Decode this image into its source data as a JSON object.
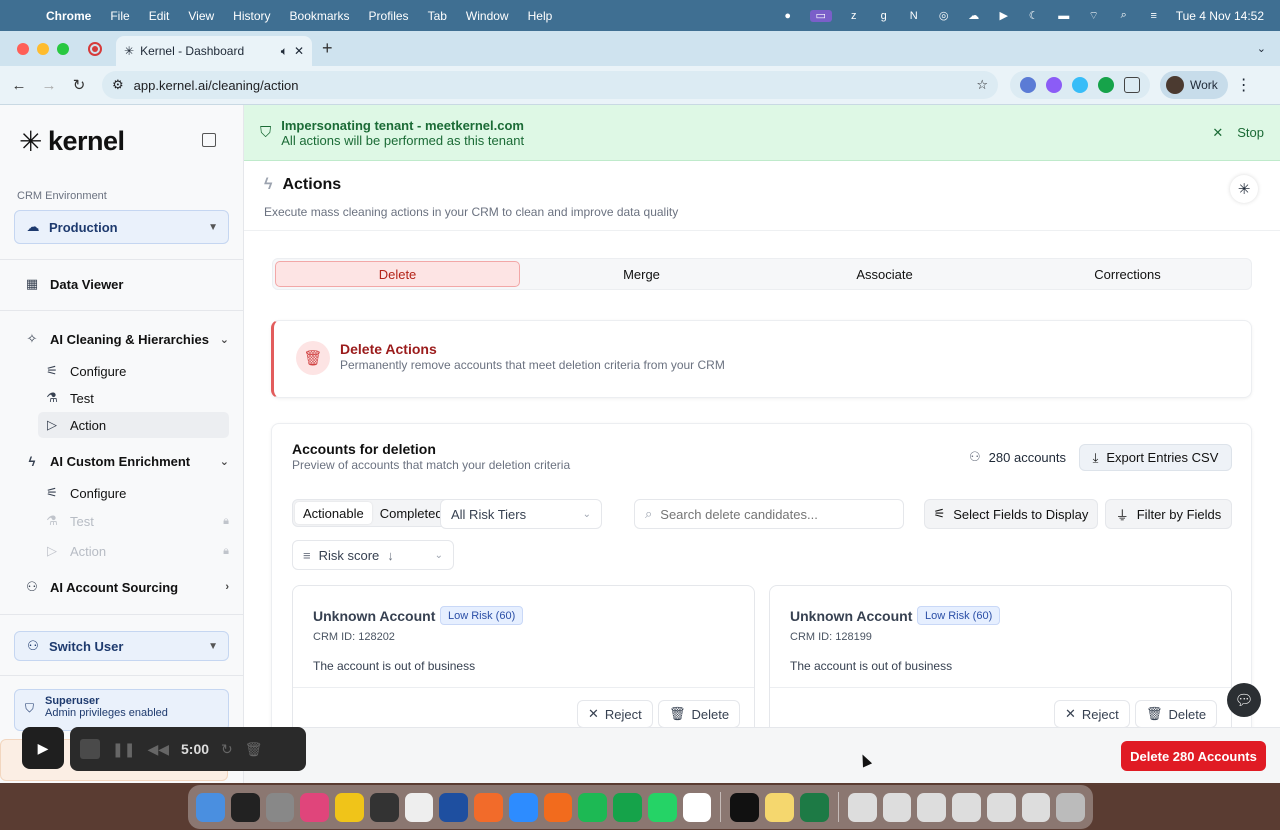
{
  "os": {
    "menubar": {
      "apple_icon": "apple-icon",
      "app_name": "Chrome",
      "menus": [
        "File",
        "Edit",
        "View",
        "History",
        "Bookmarks",
        "Profiles",
        "Tab",
        "Window",
        "Help"
      ],
      "datetime": "Tue 4 Nov  14:52"
    },
    "dock_app_count": 28
  },
  "browser": {
    "tab_title": "Kernel - Dashboard",
    "url": "app.kernel.ai/cleaning/action",
    "profile_label": "Work"
  },
  "sidebar": {
    "logo_text": "kernel",
    "env_label": "CRM Environment",
    "env_value": "Production",
    "data_viewer": "Data Viewer",
    "ai_cleaning": {
      "label": "AI Cleaning & Hierarchies",
      "items": [
        "Configure",
        "Test",
        "Action"
      ]
    },
    "ai_enrichment": {
      "label": "AI Custom Enrichment",
      "items": [
        "Configure",
        "Test",
        "Action"
      ]
    },
    "ai_sourcing": "AI Account Sourcing",
    "switch_user": "Switch User",
    "superuser_title": "Superuser",
    "superuser_sub": "Admin privileges enabled"
  },
  "banner": {
    "title": "Impersonating tenant - meetkernel.com",
    "subtitle": "All actions will be performed as this tenant",
    "stop_label": "Stop"
  },
  "page": {
    "title": "Actions",
    "subtitle": "Execute mass cleaning actions in your CRM to clean and improve data quality"
  },
  "tabs": [
    "Delete",
    "Merge",
    "Associate",
    "Corrections"
  ],
  "delete_card": {
    "title": "Delete Actions",
    "subtitle": "Permanently remove accounts that meet deletion criteria from your CRM"
  },
  "accounts": {
    "title": "Accounts for deletion",
    "subtitle": "Preview of accounts that match your deletion criteria",
    "count_label": "280 accounts",
    "export_label": "Export Entries CSV",
    "seg_actionable": "Actionable",
    "seg_completed": "Completed",
    "risk_filter": "All Risk Tiers",
    "search_placeholder": "Search delete candidates...",
    "select_fields": "Select Fields to Display",
    "filter_fields": "Filter by Fields",
    "sort_label": "Risk score",
    "cards": [
      {
        "name": "Unknown Account",
        "badge": "Low Risk (60)",
        "crm_id": "CRM ID: 128202",
        "reason": "The account is out of business",
        "reject": "Reject",
        "delete": "Delete"
      },
      {
        "name": "Unknown Account",
        "badge": "Low Risk (60)",
        "crm_id": "CRM ID: 128199",
        "reason": "The account is out of business",
        "reject": "Reject",
        "delete": "Delete"
      }
    ]
  },
  "delete_all_label": "Delete 280 Accounts",
  "recorder": {
    "time": "5:00"
  },
  "colors": {
    "danger": "#e01b24",
    "banner_bg": "#def8e5",
    "accent_blue": "#eaf1fb",
    "badge_blue": "#2b4fa7"
  }
}
